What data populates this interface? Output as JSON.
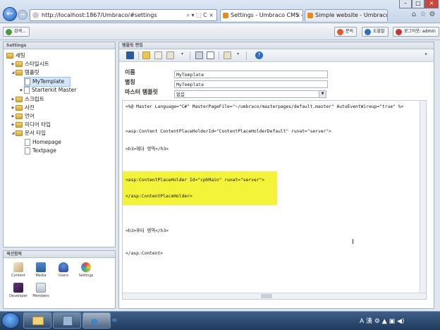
{
  "browser": {
    "address": "http://localhost:1867/Umbraco/#settings",
    "address_actions": "⌕ ▾ ⬚ C ×",
    "tabs": [
      {
        "label": "Settings - Umbraco CMS -..."
      },
      {
        "label": "Simple website - Umbraco C..."
      }
    ],
    "win_buttons": [
      "–",
      "□",
      "×"
    ],
    "right_icons": [
      "⌂",
      "☆",
      "⚙"
    ]
  },
  "umbraco": {
    "header_left_label": "검색...",
    "header_buttons": [
      {
        "label": "문의",
        "color": "#e2572b"
      },
      {
        "label": "도움말",
        "color": "#2f6fbd"
      },
      {
        "label": "로그아웃: admin",
        "color": "#c8352b"
      }
    ]
  },
  "tree": {
    "title": "Settings",
    "items": [
      {
        "label": "세팅"
      },
      {
        "label": "스타일시트"
      },
      {
        "label": "템플릿"
      },
      {
        "label": "MyTemplate"
      },
      {
        "label": "Starterkit Master"
      },
      {
        "label": "스크립트"
      },
      {
        "label": "사전"
      },
      {
        "label": "언어"
      },
      {
        "label": "미디어 타입"
      },
      {
        "label": "문서 타입"
      },
      {
        "label": "Homepage"
      },
      {
        "label": "Textpage"
      }
    ]
  },
  "sections": {
    "title": "섹션항목",
    "items": [
      {
        "label": "Content"
      },
      {
        "label": "Media"
      },
      {
        "label": "Users"
      },
      {
        "label": "Settings"
      },
      {
        "label": "Developer"
      },
      {
        "label": "Members"
      }
    ]
  },
  "editor": {
    "title": "템플릿 편집",
    "fields": {
      "name_label": "이름",
      "name_value": "MyTemplate",
      "alias_label": "별칭",
      "alias_value": "MyTemplate",
      "master_label": "마스터 템플릿",
      "master_value": "없음"
    },
    "code_lines": [
      "<%@ Master Language=\"C#\" MasterPageFile=\"~/umbraco/masterpages/default.master\" AutoEventWireup=\"true\" %>",
      "<asp:Content ContentPlaceHolderId=\"ContentPlaceHolderDefault\" runat=\"server\">",
      "<h3>헤더 영역</h3>",
      "<asp:ContentPlaceHolder Id=\"cphMain\" runat=\"server\">",
      "</asp:ContentPlaceHolder>",
      "<h3>푸터 영역</h3>",
      "</asp:Content>"
    ]
  },
  "taskbar": {
    "tray_text": "A 漢 ⚙ ▲ ▣ ◀)"
  }
}
